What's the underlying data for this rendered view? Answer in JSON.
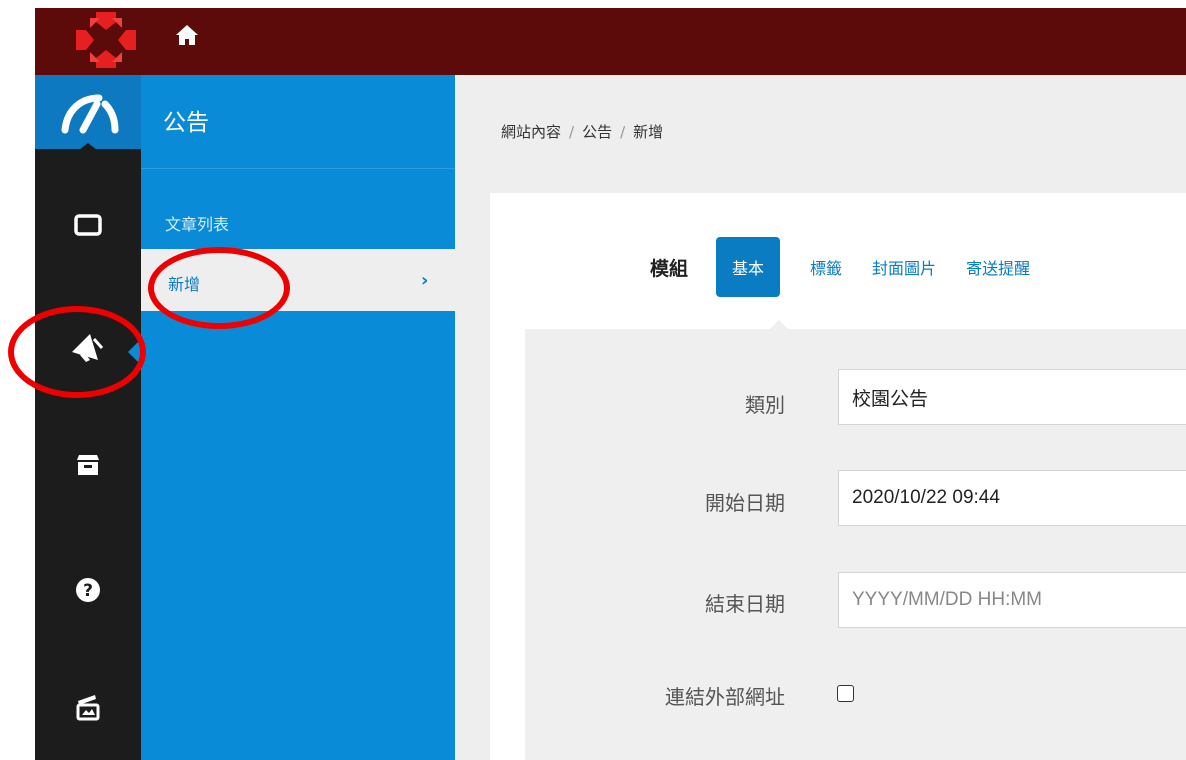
{
  "top_bar": {
    "logo_icon": "cross-logo-icon",
    "home_icon": "home-icon"
  },
  "icon_sidebar": {
    "items": [
      {
        "icon": "dashboard-icon"
      },
      {
        "icon": "window-icon"
      },
      {
        "icon": "megaphone-icon",
        "active": true
      },
      {
        "icon": "archive-icon"
      },
      {
        "icon": "help-icon"
      },
      {
        "icon": "media-icon"
      }
    ]
  },
  "submenu": {
    "title": "公告",
    "items": [
      {
        "label": "文章列表"
      },
      {
        "label": "新增",
        "chevron": "›",
        "active": true
      }
    ]
  },
  "breadcrumb": {
    "items": [
      "網站內容",
      "公告",
      "新增"
    ],
    "separator": "/"
  },
  "tabs": {
    "label": "模組",
    "items": [
      {
        "label": "基本",
        "active": true
      },
      {
        "label": "標籤"
      },
      {
        "label": "封面圖片"
      },
      {
        "label": "寄送提醒"
      }
    ]
  },
  "form": {
    "category": {
      "label": "類別",
      "value": "校園公告"
    },
    "start_date": {
      "label": "開始日期",
      "value": "2020/10/22 09:44"
    },
    "end_date": {
      "label": "結束日期",
      "value": "",
      "placeholder": "YYYY/MM/DD HH:MM"
    },
    "external_link": {
      "label": "連結外部網址",
      "checked": false
    }
  },
  "colors": {
    "top_bar": "#5c0a0a",
    "icon_sidebar": "#1c1c1c",
    "submenu": "#0a8bd7",
    "accent": "#0a7cc2",
    "annotation": "#ee0000"
  }
}
